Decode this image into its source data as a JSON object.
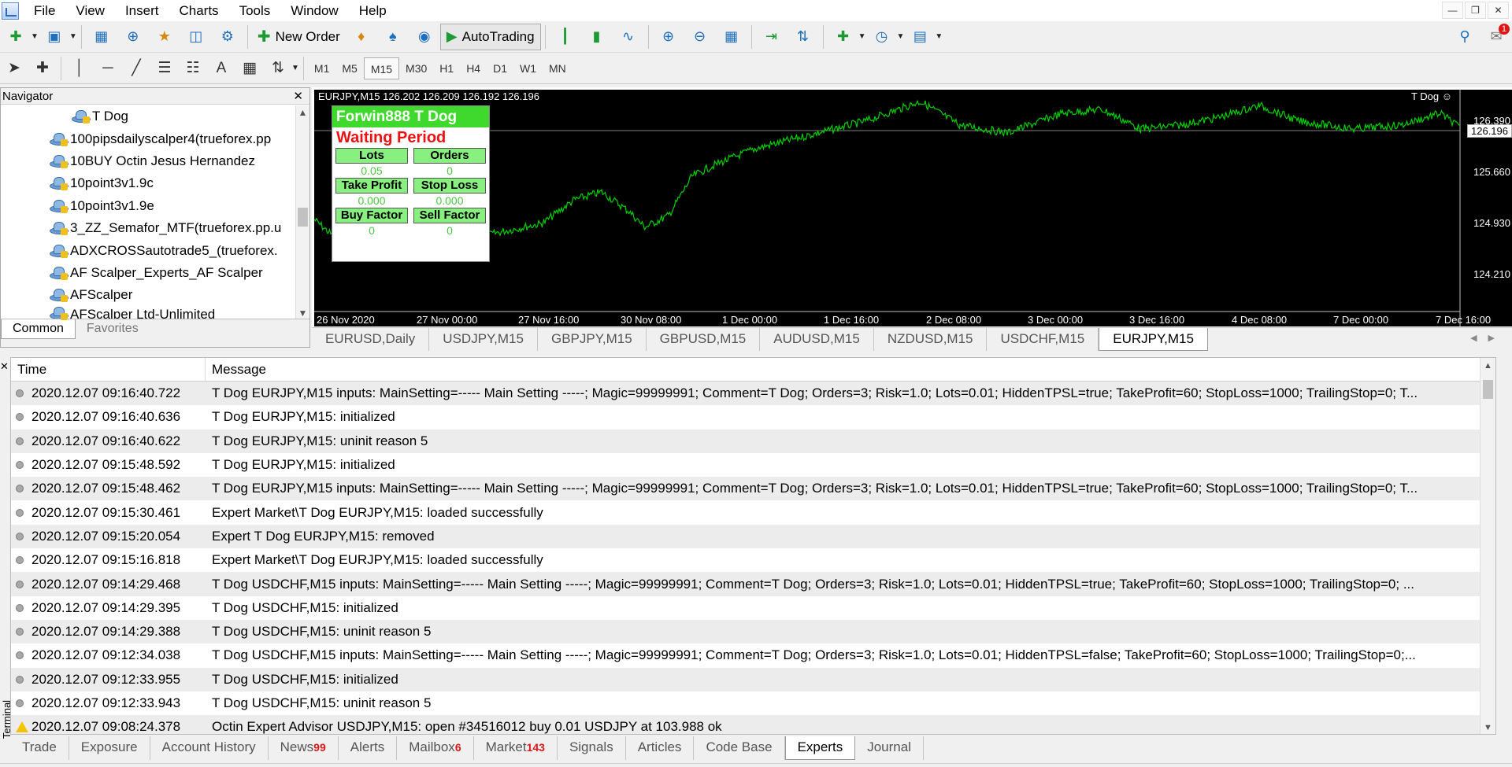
{
  "menu": [
    "File",
    "View",
    "Insert",
    "Charts",
    "Tools",
    "Window",
    "Help"
  ],
  "toolbar": {
    "new_order": "New Order",
    "autotrading": "AutoTrading",
    "timeframes": [
      "M1",
      "M5",
      "M15",
      "M30",
      "H1",
      "H4",
      "D1",
      "W1",
      "MN"
    ],
    "active_timeframe": "M15",
    "notification_badge": "1"
  },
  "navigator": {
    "title": "Navigator",
    "items": [
      "T Dog",
      "100pipsdailyscalper4(trueforex.pp",
      "10BUY Octin Jesus Hernandez",
      "10point3v1.9c",
      "10point3v1.9e",
      "3_ZZ_Semafor_MTF(trueforex.pp.u",
      "ADXCROSSautotrade5_(trueforex.",
      "AF Scalper_Experts_AF Scalper",
      "AFScalper",
      "AFScalper Ltd-Unlimited"
    ],
    "tabs": [
      "Common",
      "Favorites"
    ]
  },
  "chart": {
    "symbol_info": "EURJPY,M15  126.202 126.209 126.192 126.196",
    "ea_name": "T Dog ☺",
    "current_price": "126.196",
    "y_ticks": [
      "126.390",
      "125.660",
      "124.930",
      "124.210"
    ],
    "x_ticks": [
      "26 Nov 2020",
      "27 Nov 00:00",
      "27 Nov 16:00",
      "30 Nov 08:00",
      "1 Dec 00:00",
      "1 Dec 16:00",
      "2 Dec 08:00",
      "3 Dec 00:00",
      "3 Dec 16:00",
      "4 Dec 08:00",
      "7 Dec 00:00",
      "7 Dec 16:00"
    ],
    "line_color": "#00d000"
  },
  "ea_panel": {
    "title": "Forwin888 T Dog",
    "status": "Waiting Period",
    "lots_label": "Lots",
    "lots_value": "0.05",
    "orders_label": "Orders",
    "orders_value": "0",
    "tp_label": "Take Profit",
    "tp_value": "0.000",
    "sl_label": "Stop Loss",
    "sl_value": "0.000",
    "buy_label": "Buy Factor",
    "buy_value": "0",
    "sell_label": "Sell Factor",
    "sell_value": "0"
  },
  "chart_tabs": [
    "EURUSD,Daily",
    "USDJPY,M15",
    "GBPJPY,M15",
    "GBPUSD,M15",
    "AUDUSD,M15",
    "NZDUSD,M15",
    "USDCHF,M15",
    "EURJPY,M15"
  ],
  "active_chart_tab": "EURJPY,M15",
  "terminal": {
    "side_label": "Terminal",
    "columns": [
      "Time",
      "Message"
    ],
    "rows": [
      {
        "type": "info",
        "time": "2020.12.07 09:16:40.722",
        "message": "T Dog EURJPY,M15 inputs: MainSetting=----- Main Setting -----; Magic=99999991; Comment=T Dog; Orders=3; Risk=1.0; Lots=0.01; HiddenTPSL=true; TakeProfit=60; StopLoss=1000; TrailingStop=0; T..."
      },
      {
        "type": "info",
        "time": "2020.12.07 09:16:40.636",
        "message": "T Dog EURJPY,M15: initialized"
      },
      {
        "type": "info",
        "time": "2020.12.07 09:16:40.622",
        "message": "T Dog EURJPY,M15: uninit reason 5"
      },
      {
        "type": "info",
        "time": "2020.12.07 09:15:48.592",
        "message": "T Dog EURJPY,M15: initialized"
      },
      {
        "type": "info",
        "time": "2020.12.07 09:15:48.462",
        "message": "T Dog EURJPY,M15 inputs: MainSetting=----- Main Setting -----; Magic=99999991; Comment=T Dog; Orders=3; Risk=1.0; Lots=0.01; HiddenTPSL=true; TakeProfit=60; StopLoss=1000; TrailingStop=0; T..."
      },
      {
        "type": "info",
        "time": "2020.12.07 09:15:30.461",
        "message": "Expert Market\\T Dog EURJPY,M15: loaded successfully"
      },
      {
        "type": "info",
        "time": "2020.12.07 09:15:20.054",
        "message": "Expert T Dog EURJPY,M15: removed"
      },
      {
        "type": "info",
        "time": "2020.12.07 09:15:16.818",
        "message": "Expert Market\\T Dog EURJPY,M15: loaded successfully"
      },
      {
        "type": "info",
        "time": "2020.12.07 09:14:29.468",
        "message": "T Dog USDCHF,M15 inputs: MainSetting=----- Main Setting -----; Magic=99999991; Comment=T Dog; Orders=3; Risk=1.0; Lots=0.01; HiddenTPSL=true; TakeProfit=60; StopLoss=1000; TrailingStop=0; ..."
      },
      {
        "type": "info",
        "time": "2020.12.07 09:14:29.395",
        "message": "T Dog USDCHF,M15: initialized"
      },
      {
        "type": "info",
        "time": "2020.12.07 09:14:29.388",
        "message": "T Dog USDCHF,M15: uninit reason 5"
      },
      {
        "type": "info",
        "time": "2020.12.07 09:12:34.038",
        "message": "T Dog USDCHF,M15 inputs: MainSetting=----- Main Setting -----; Magic=99999991; Comment=T Dog; Orders=3; Risk=1.0; Lots=0.01; HiddenTPSL=false; TakeProfit=60; StopLoss=1000; TrailingStop=0;..."
      },
      {
        "type": "info",
        "time": "2020.12.07 09:12:33.955",
        "message": "T Dog USDCHF,M15: initialized"
      },
      {
        "type": "info",
        "time": "2020.12.07 09:12:33.943",
        "message": "T Dog USDCHF,M15: uninit reason 5"
      },
      {
        "type": "warning",
        "time": "2020.12.07 09:08:24.378",
        "message": "Octin Expert Advisor USDJPY,M15: open #34516012 buy 0.01 USDJPY at 103.988 ok"
      }
    ],
    "tabs": [
      {
        "label": "Trade",
        "count": ""
      },
      {
        "label": "Exposure",
        "count": ""
      },
      {
        "label": "Account History",
        "count": ""
      },
      {
        "label": "News",
        "count": "99"
      },
      {
        "label": "Alerts",
        "count": ""
      },
      {
        "label": "Mailbox",
        "count": "6"
      },
      {
        "label": "Market",
        "count": "143"
      },
      {
        "label": "Signals",
        "count": ""
      },
      {
        "label": "Articles",
        "count": ""
      },
      {
        "label": "Code Base",
        "count": ""
      },
      {
        "label": "Experts",
        "count": ""
      },
      {
        "label": "Journal",
        "count": ""
      }
    ],
    "active_tab": "Experts"
  }
}
